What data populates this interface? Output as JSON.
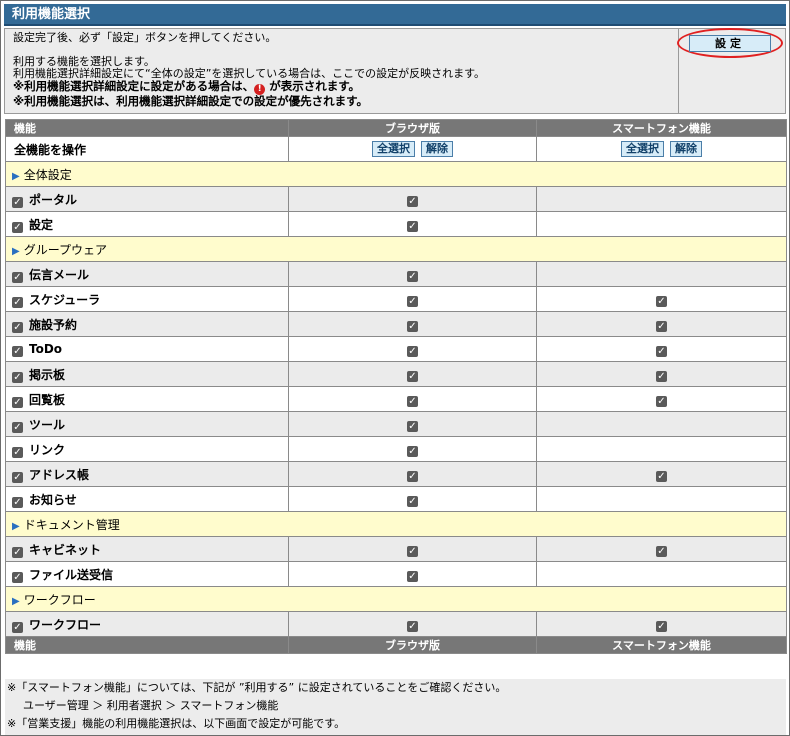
{
  "window": {
    "title": "利用機能選択"
  },
  "info": {
    "line1": "設定完了後、必ず「設定」ボタンを押してください。",
    "line2": "利用する機能を選択します。",
    "line3": "利用機能選択詳細設定にて“全体の設定”を選択している場合は、ここでの設定が反映されます。",
    "line4_pre": "※利用機能選択詳細設定に設定がある場合は、",
    "line4_icon": "!",
    "line4_post": " が表示されます。",
    "line5": "※利用機能選択は、利用機能選択詳細設定での設定が優先されます。",
    "set_button": "設定"
  },
  "table": {
    "headers": {
      "function": "機能",
      "browser": "ブラウザ版",
      "smartphone": "スマートフォン機能"
    },
    "all_row": {
      "label": "全機能を操作",
      "select_all": "全選択",
      "clear": "解除"
    },
    "sections": [
      {
        "title": "全体設定",
        "items": [
          {
            "label": "ポータル",
            "browser": true,
            "smartphone": false
          },
          {
            "label": "設定",
            "browser": true,
            "smartphone": false
          }
        ]
      },
      {
        "title": "グループウェア",
        "items": [
          {
            "label": "伝言メール",
            "browser": true,
            "smartphone": false
          },
          {
            "label": "スケジューラ",
            "browser": true,
            "smartphone": true
          },
          {
            "label": "施設予約",
            "browser": true,
            "smartphone": true
          },
          {
            "label": "ToDo",
            "browser": true,
            "smartphone": true
          },
          {
            "label": "掲示板",
            "browser": true,
            "smartphone": true
          },
          {
            "label": "回覧板",
            "browser": true,
            "smartphone": true
          },
          {
            "label": "ツール",
            "browser": true,
            "smartphone": false
          },
          {
            "label": "リンク",
            "browser": true,
            "smartphone": false
          },
          {
            "label": "アドレス帳",
            "browser": true,
            "smartphone": true
          },
          {
            "label": "お知らせ",
            "browser": true,
            "smartphone": false
          }
        ]
      },
      {
        "title": "ドキュメント管理",
        "items": [
          {
            "label": "キャビネット",
            "browser": true,
            "smartphone": true
          },
          {
            "label": "ファイル送受信",
            "browser": true,
            "smartphone": false
          }
        ]
      },
      {
        "title": "ワークフロー",
        "items": [
          {
            "label": "ワークフロー",
            "browser": true,
            "smartphone": true
          }
        ]
      }
    ]
  },
  "notes": {
    "line1": "※「スマートフォン機能」については、下記が ”利用する” に設定されていることをご確認ください。",
    "line2": "ユーザー管理 ＞ 利用者選択 ＞ スマートフォン機能",
    "line3": "※「営業支援」機能の利用機能選択は、以下画面で設定が可能です。"
  },
  "colors": {
    "titlebar": "#336a96",
    "section_bg": "#fffccd",
    "header_bg": "#777777",
    "button_bg": "#d7ecf8",
    "highlight_ring": "#e02020"
  },
  "icons": {
    "check": "checkbox-checked-icon",
    "section": "triangle-right-icon",
    "warning": "exclamation-icon"
  }
}
